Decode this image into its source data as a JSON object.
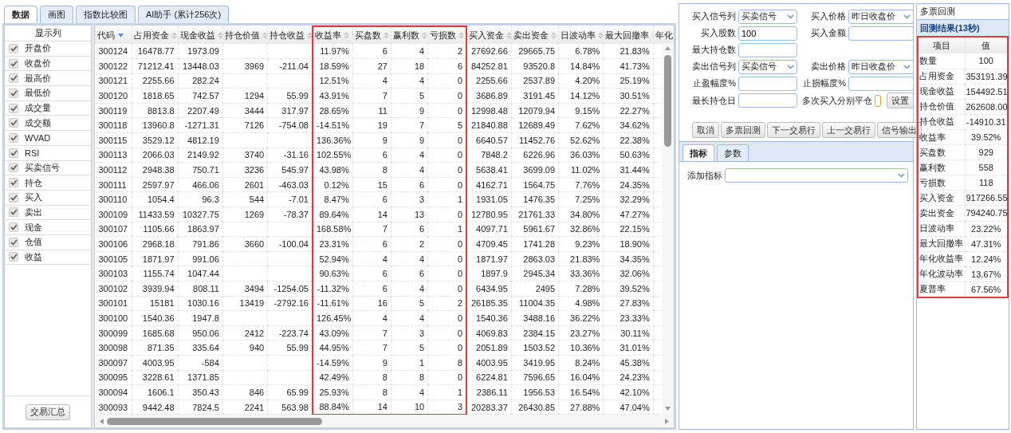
{
  "main_tabs": [
    {
      "label": "数据",
      "selected": true
    },
    {
      "label": "画图",
      "selected": false
    },
    {
      "label": "指数比较图",
      "selected": false
    },
    {
      "label": "AI助手 (累计256次)",
      "selected": false
    }
  ],
  "sidebar": {
    "title": "显示列",
    "items": [
      {
        "label": "开盘价",
        "checked": true
      },
      {
        "label": "收盘价",
        "checked": true
      },
      {
        "label": "最高价",
        "checked": true
      },
      {
        "label": "最低价",
        "checked": true
      },
      {
        "label": "成交量",
        "checked": true
      },
      {
        "label": "成交额",
        "checked": true
      },
      {
        "label": "WVAD",
        "checked": true
      },
      {
        "label": "RSI",
        "checked": true
      },
      {
        "label": "买卖信号",
        "checked": true
      },
      {
        "label": "持仓",
        "checked": true
      },
      {
        "label": "买入",
        "checked": true
      },
      {
        "label": "卖出",
        "checked": true
      },
      {
        "label": "现金",
        "checked": true
      },
      {
        "label": "仓值",
        "checked": true
      },
      {
        "label": "收益",
        "checked": true
      }
    ],
    "button": "交易汇总"
  },
  "table": {
    "columns": [
      {
        "label": "代码",
        "sorted": true,
        "highlighted": false
      },
      {
        "label": "占用资金",
        "sorted": false,
        "highlighted": false
      },
      {
        "label": "现金收益",
        "sorted": false,
        "highlighted": false
      },
      {
        "label": "持仓价值",
        "sorted": false,
        "highlighted": false
      },
      {
        "label": "持仓收益",
        "sorted": false,
        "highlighted": false
      },
      {
        "label": "收益率",
        "sorted": false,
        "highlighted": true
      },
      {
        "label": "买盘数",
        "sorted": false,
        "highlighted": true
      },
      {
        "label": "赢利数",
        "sorted": false,
        "highlighted": true
      },
      {
        "label": "亏损数",
        "sorted": false,
        "highlighted": true
      },
      {
        "label": "买入资金",
        "sorted": false,
        "highlighted": false
      },
      {
        "label": "卖出资金",
        "sorted": false,
        "highlighted": false
      },
      {
        "label": "日波动率",
        "sorted": false,
        "highlighted": false
      },
      {
        "label": "最大回撤率",
        "sorted": false,
        "highlighted": false
      },
      {
        "label": "年化",
        "highlighted": false
      }
    ],
    "rows": [
      {
        "cells": [
          "300124",
          "16478.77",
          "1973.09",
          null,
          null,
          "11.97%",
          "6",
          "4",
          "2",
          "27692.66",
          "29665.75",
          "6.78%",
          "21.83%"
        ]
      },
      {
        "cells": [
          "300122",
          "71212.41",
          "13448.03",
          "3969",
          "-211.04",
          "18.59%",
          "27",
          "18",
          "6",
          "84252.81",
          "93520.8",
          "14.84%",
          "41.73%"
        ]
      },
      {
        "cells": [
          "300121",
          "2255.66",
          "282.24",
          null,
          null,
          "12.51%",
          "4",
          "4",
          "0",
          "2255.66",
          "2537.89",
          "4.20%",
          "25.19%"
        ]
      },
      {
        "cells": [
          "300120",
          "1818.65",
          "742.57",
          "1294",
          "55.99",
          "43.91%",
          "7",
          "5",
          "0",
          "3686.89",
          "3191.45",
          "14.12%",
          "30.51%"
        ]
      },
      {
        "cells": [
          "300119",
          "8813.8",
          "2207.49",
          "3444",
          "317.97",
          "28.65%",
          "11",
          "9",
          "0",
          "12998.48",
          "12079.94",
          "9.15%",
          "22.27%"
        ]
      },
      {
        "cells": [
          "300118",
          "13960.8",
          "-1271.31",
          "7126",
          "-754.08",
          "-14.51%",
          "19",
          "7",
          "5",
          "21840.88",
          "12689.49",
          "7.62%",
          "34.62%"
        ]
      },
      {
        "cells": [
          "300115",
          "3529.12",
          "4812.19",
          null,
          null,
          "136.36%",
          "9",
          "9",
          "0",
          "6640.57",
          "11452.76",
          "52.62%",
          "22.38%"
        ]
      },
      {
        "cells": [
          "300113",
          "2066.03",
          "2149.92",
          "3740",
          "-31.16",
          "102.55%",
          "6",
          "4",
          "0",
          "7848.2",
          "6226.96",
          "36.03%",
          "50.63%"
        ]
      },
      {
        "cells": [
          "300112",
          "2948.38",
          "750.71",
          "3236",
          "545.97",
          "43.98%",
          "8",
          "4",
          "0",
          "5638.41",
          "3699.09",
          "11.02%",
          "31.44%"
        ]
      },
      {
        "cells": [
          "300111",
          "2597.97",
          "466.06",
          "2601",
          "-463.03",
          "0.12%",
          "15",
          "6",
          "0",
          "4162.71",
          "1564.75",
          "7.76%",
          "24.35%"
        ]
      },
      {
        "cells": [
          "300110",
          "1054.4",
          "96.3",
          "544",
          "-7.01",
          "8.47%",
          "6",
          "3",
          "1",
          "1931.05",
          "1476.35",
          "7.25%",
          "32.29%"
        ]
      },
      {
        "cells": [
          "300109",
          "11433.59",
          "10327.75",
          "1269",
          "-78.37",
          "89.64%",
          "14",
          "13",
          "0",
          "12780.95",
          "21761.33",
          "34.80%",
          "47.27%"
        ]
      },
      {
        "cells": [
          "300107",
          "1105.66",
          "1863.97",
          null,
          null,
          "168.58%",
          "7",
          "6",
          "1",
          "4097.71",
          "5961.67",
          "32.86%",
          "22.15%"
        ]
      },
      {
        "cells": [
          "300106",
          "2968.18",
          "791.86",
          "3660",
          "-100.04",
          "23.31%",
          "6",
          "2",
          "0",
          "4709.45",
          "1741.28",
          "9.23%",
          "18.90%"
        ]
      },
      {
        "cells": [
          "300105",
          "1871.97",
          "991.06",
          null,
          null,
          "52.94%",
          "4",
          "4",
          "0",
          "1871.97",
          "2863.03",
          "21.83%",
          "34.35%"
        ]
      },
      {
        "cells": [
          "300103",
          "1155.74",
          "1047.44",
          null,
          null,
          "90.63%",
          "6",
          "6",
          "0",
          "1897.9",
          "2945.34",
          "33.36%",
          "32.06%"
        ]
      },
      {
        "cells": [
          "300102",
          "3939.94",
          "808.11",
          "3494",
          "-1254.05",
          "-11.32%",
          "6",
          "4",
          "0",
          "6434.95",
          "2495",
          "7.28%",
          "39.52%"
        ]
      },
      {
        "cells": [
          "300101",
          "15181",
          "1030.16",
          "13419",
          "-2792.16",
          "-11.61%",
          "16",
          "5",
          "2",
          "26185.35",
          "11004.35",
          "4.98%",
          "27.83%"
        ]
      },
      {
        "cells": [
          "300100",
          "1540.36",
          "1947.8",
          null,
          null,
          "126.45%",
          "4",
          "4",
          "0",
          "1540.36",
          "3488.16",
          "36.22%",
          "23.33%"
        ]
      },
      {
        "cells": [
          "300099",
          "1685.68",
          "950.06",
          "2412",
          "-223.74",
          "43.09%",
          "7",
          "3",
          "0",
          "4069.83",
          "2384.15",
          "23.27%",
          "30.11%"
        ]
      },
      {
        "cells": [
          "300098",
          "871.35",
          "335.64",
          "940",
          "55.99",
          "44.95%",
          "7",
          "5",
          "0",
          "2051.89",
          "1503.52",
          "10.36%",
          "31.01%"
        ]
      },
      {
        "cells": [
          "300097",
          "4003.95",
          "-584",
          null,
          null,
          "-14.59%",
          "9",
          "1",
          "8",
          "4003.95",
          "3419.95",
          "8.24%",
          "45.38%"
        ]
      },
      {
        "cells": [
          "300095",
          "3228.61",
          "1371.85",
          null,
          null,
          "42.49%",
          "8",
          "8",
          "0",
          "6224.81",
          "7596.65",
          "16.04%",
          "24.23%"
        ]
      },
      {
        "cells": [
          "300094",
          "1606.1",
          "350.43",
          "846",
          "65.99",
          "25.93%",
          "8",
          "4",
          "1",
          "2386.11",
          "1956.53",
          "16.54%",
          "42.10%"
        ]
      },
      {
        "cells": [
          "300093",
          "9442.48",
          "7824.5",
          "2241",
          "563.98",
          "88.84%",
          "14",
          "10",
          "3",
          "20283.37",
          "26430.85",
          "27.88%",
          "47.04%"
        ]
      }
    ]
  },
  "form": {
    "rows": [
      [
        {
          "kind": "select",
          "label": "买入信号列",
          "value": "买卖信号"
        },
        {
          "kind": "select",
          "label": "买入价格",
          "value": "昨日收盘价"
        }
      ],
      [
        {
          "kind": "input",
          "label": "买入股数",
          "value": "100"
        },
        {
          "kind": "input",
          "label": "买入金额"
        }
      ],
      [
        {
          "kind": "input",
          "label": "最大持仓数"
        }
      ],
      [
        {
          "kind": "select",
          "label": "卖出信号列",
          "value": "买卖信号"
        },
        {
          "kind": "select",
          "label": "卖出价格",
          "value": "昨日收盘价"
        }
      ],
      [
        {
          "kind": "input",
          "label": "止盈幅度%"
        },
        {
          "kind": "input",
          "label": "止损幅度%"
        }
      ],
      [
        {
          "kind": "input",
          "label": "最长持仓日"
        },
        {
          "kind": "checkbox",
          "label": "多次买入分别平仓",
          "checked": false,
          "button": "设置"
        }
      ]
    ],
    "buttons": [
      "取消",
      "多票回测",
      "下一交易行",
      "上一交易行",
      "信号输出"
    ]
  },
  "lower_tabs": [
    {
      "label": "指标",
      "selected": true
    },
    {
      "label": "参数",
      "selected": false
    }
  ],
  "indicator": {
    "label": "添加指标"
  },
  "results": {
    "title": "多票回测",
    "header": "回测结果(13秒)",
    "highlighted": true,
    "columns": [
      "项目",
      "值"
    ],
    "rows": [
      [
        "数量",
        "100"
      ],
      [
        "占用资金",
        "353191.39"
      ],
      [
        "现金收益",
        "154492.51"
      ],
      [
        "持仓价值",
        "262608.00"
      ],
      [
        "持仓收益",
        "-14910.31"
      ],
      [
        "收益率",
        "39.52%"
      ],
      [
        "买盘数",
        "929"
      ],
      [
        "赢利数",
        "558"
      ],
      [
        "亏损数",
        "118"
      ],
      [
        "买入资金",
        "917266.55"
      ],
      [
        "卖出资金",
        "794240.75"
      ],
      [
        "日波动率",
        "23.22%"
      ],
      [
        "最大回撤率",
        "47.31%"
      ],
      [
        "年化收益率",
        "12.24%"
      ],
      [
        "年化波动率",
        "13.67%"
      ],
      [
        "夏普率",
        "67.56%"
      ]
    ]
  }
}
